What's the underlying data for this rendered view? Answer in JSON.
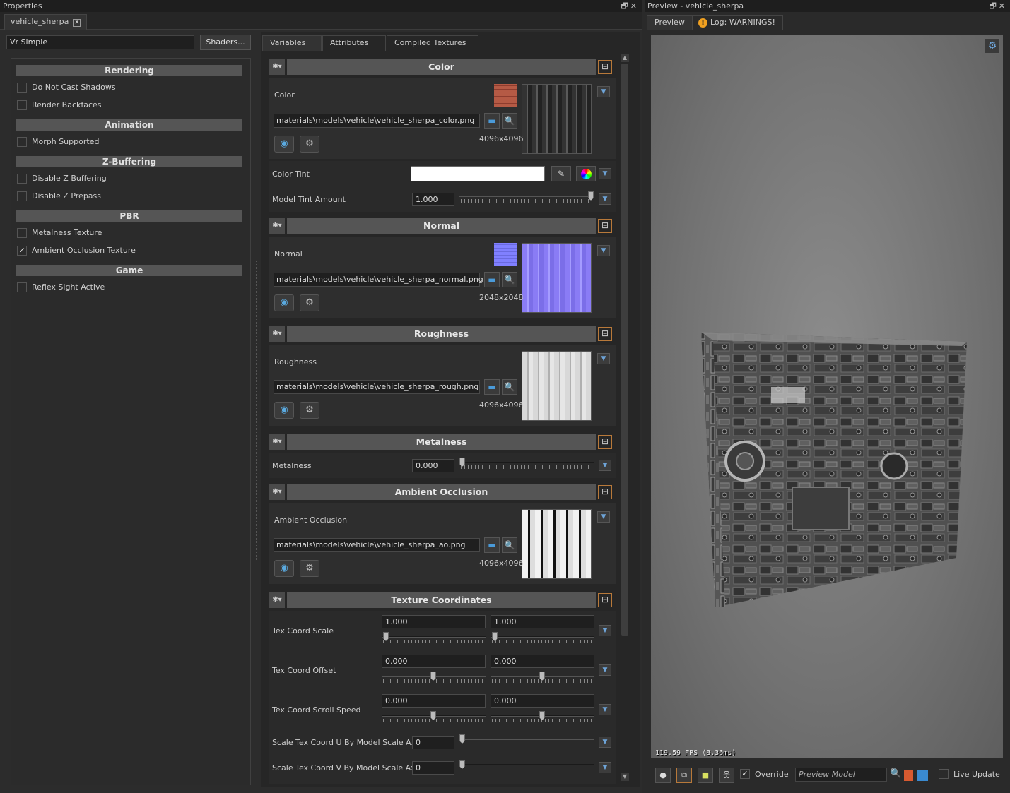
{
  "properties": {
    "title": "Properties",
    "doc_tab": "vehicle_sherpa",
    "shader_field": "Vr Simple",
    "shaders_button": "Shaders...",
    "sections": [
      {
        "title": "Rendering",
        "options": [
          {
            "label": "Do Not Cast Shadows",
            "checked": false
          },
          {
            "label": "Render Backfaces",
            "checked": false
          }
        ]
      },
      {
        "title": "Animation",
        "options": [
          {
            "label": "Morph Supported",
            "checked": false
          }
        ]
      },
      {
        "title": "Z-Buffering",
        "options": [
          {
            "label": "Disable Z Buffering",
            "checked": false
          },
          {
            "label": "Disable Z Prepass",
            "checked": false
          }
        ]
      },
      {
        "title": "PBR",
        "options": [
          {
            "label": "Metalness Texture",
            "checked": false
          },
          {
            "label": "Ambient Occlusion Texture",
            "checked": true
          }
        ]
      },
      {
        "title": "Game",
        "options": [
          {
            "label": "Reflex Sight Active",
            "checked": false
          }
        ]
      }
    ],
    "tabs": {
      "variables": "Variables",
      "attributes": "Attributes",
      "compiled": "Compiled Textures"
    }
  },
  "groups": {
    "color": {
      "title": "Color",
      "tex_label": "Color",
      "path": "materials\\models\\vehicle\\vehicle_sherpa_color.png",
      "resolution": "4096x4096",
      "tint_label": "Color Tint",
      "tint_value": "#ffffff",
      "model_tint_label": "Model Tint Amount",
      "model_tint_value": "1.000",
      "model_tint_fraction": 1.0
    },
    "normal": {
      "title": "Normal",
      "tex_label": "Normal",
      "path": "materials\\models\\vehicle\\vehicle_sherpa_normal.png",
      "resolution": "2048x2048"
    },
    "roughness": {
      "title": "Roughness",
      "tex_label": "Roughness",
      "path": "materials\\models\\vehicle\\vehicle_sherpa_rough.png",
      "resolution": "4096x4096"
    },
    "metalness": {
      "title": "Metalness",
      "label": "Metalness",
      "value": "0.000",
      "fraction": 0.0
    },
    "ao": {
      "title": "Ambient Occlusion",
      "tex_label": "Ambient Occlusion",
      "path": "materials\\models\\vehicle\\vehicle_sherpa_ao.png",
      "resolution": "4096x4096"
    },
    "texcoords": {
      "title": "Texture Coordinates",
      "scale_label": "Tex Coord Scale",
      "scale_u": "1.000",
      "scale_v": "1.000",
      "offset_label": "Tex Coord Offset",
      "offset_u": "0.000",
      "offset_v": "0.000",
      "scroll_label": "Tex Coord Scroll Speed",
      "scroll_u": "0.000",
      "scroll_v": "0.000",
      "axis_u_label": "Scale Tex Coord U By Model Scale Axis",
      "axis_u_value": "0",
      "axis_v_label": "Scale Tex Coord V By Model Scale Axis",
      "axis_v_value": "0"
    }
  },
  "preview": {
    "title": "Preview - vehicle_sherpa",
    "tab_preview": "Preview",
    "tab_log": "Log: WARNINGS!",
    "fps": "119.59 FPS (8.36ms)",
    "override_label": "Override",
    "override_checked": true,
    "model_placeholder": "Preview Model",
    "live_update_label": "Live Update",
    "live_update_checked": false
  },
  "colors": {
    "accent_orange": "#b8793a",
    "warning": "#f0a020",
    "panel": "#2c2c2c",
    "header": "#555555"
  }
}
